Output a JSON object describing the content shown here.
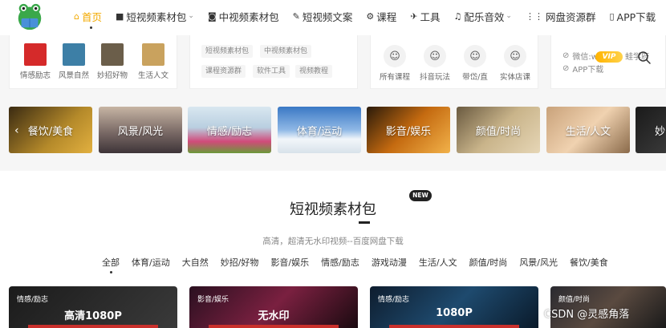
{
  "nav": {
    "items": [
      {
        "label": "首页",
        "icon": "home-icon",
        "glyph": "⌂"
      },
      {
        "label": "短视频素材包",
        "icon": "video-camera-icon",
        "glyph": "■",
        "caret": "⌄"
      },
      {
        "label": "中视频素材包",
        "icon": "camera-icon",
        "glyph": "◙"
      },
      {
        "label": "短视频文案",
        "icon": "pen-icon",
        "glyph": "✎"
      },
      {
        "label": "课程",
        "icon": "gear-icon",
        "glyph": "⚙"
      },
      {
        "label": "工具",
        "icon": "pin-icon",
        "glyph": "✈"
      },
      {
        "label": "配乐音效",
        "icon": "music-icon",
        "glyph": "♫",
        "caret": "⌄"
      },
      {
        "label": "网盘资源群",
        "icon": "grid-icon",
        "glyph": "⋮⋮"
      },
      {
        "label": "APP下载",
        "icon": "phone-icon",
        "glyph": "▯"
      }
    ]
  },
  "panel1": {
    "items": [
      {
        "label": "情感励志",
        "color": "#d52a2a"
      },
      {
        "label": "风景自然",
        "color": "#3d7fa6"
      },
      {
        "label": "妙招好物",
        "color": "#6b5e4a"
      },
      {
        "label": "生活人文",
        "color": "#c9a25e"
      }
    ]
  },
  "panel2": {
    "tags": [
      "短视频素材包",
      "中视频素材包",
      "课程资源群",
      "软件工具",
      "视频教程"
    ]
  },
  "panel3": {
    "items": [
      {
        "label": "所有课程",
        "glyph": "☺"
      },
      {
        "label": "抖音玩法",
        "glyph": "☺"
      },
      {
        "label": "带岱/直",
        "glyph": "☺"
      },
      {
        "label": "实体店课",
        "glyph": "☺"
      }
    ]
  },
  "panel4": {
    "wechat": "微信:w",
    "wechat_suffix": "蛙学府",
    "app": "APP下载",
    "vip": "VIP"
  },
  "strip": {
    "prev": "‹",
    "cats": [
      {
        "label": "餐饮/美食",
        "bg": "linear-gradient(135deg,#3a2a12,#b58a2a 60%,#e2b040)"
      },
      {
        "label": "风景/风光",
        "bg": "linear-gradient(180deg,#c7b5a4,#7a6a66 55%,#3e3438)"
      },
      {
        "label": "情感/励志",
        "bg": "linear-gradient(180deg,#d9e7f0,#b9cfe0 45%,#d14a7a 75%,#6a9a3a)"
      },
      {
        "label": "体育/运动",
        "bg": "linear-gradient(180deg,#3a78c4,#8fb8e6 50%,#f2f6fa 70%,#d8e2ea)"
      },
      {
        "label": "影音/娱乐",
        "bg": "linear-gradient(135deg,#2a1a0a,#c46a10 50%,#f2b24a)"
      },
      {
        "label": "颜值/时尚",
        "bg": "linear-gradient(135deg,#6a5a40,#c9b48a 50%,#e6d6b6)"
      },
      {
        "label": "生活/人文",
        "bg": "linear-gradient(135deg,#c9a27a,#f0d2b0 50%,#8a6a4a)"
      },
      {
        "label": "妙",
        "bg": "linear-gradient(135deg,#1a1a1a,#3a3a3a)"
      }
    ]
  },
  "section": {
    "title": "短视频素材包",
    "badge": "NEW",
    "subtitle": "高清，超清无水印视频--百度网盘下载",
    "filters": [
      "全部",
      "体育/运动",
      "大自然",
      "妙招/好物",
      "影音/娱乐",
      "情感/励志",
      "游戏动漫",
      "生活/人文",
      "颜值/时尚",
      "风景/风光",
      "餐饮/美食"
    ]
  },
  "cards": [
    {
      "tag": "情感/励志",
      "title": "高清1080P",
      "bg": "linear-gradient(135deg,#1b1b1b,#3a3a3a)"
    },
    {
      "tag": "影音/娱乐",
      "title": "无水印",
      "bg": "linear-gradient(135deg,#2a1020,#7a2040 50%,#1a0a10)"
    },
    {
      "tag": "情感/励志",
      "title": "1080P",
      "bg": "linear-gradient(135deg,#0e1d2e,#1e4a6e 50%,#0a1a2a)"
    },
    {
      "tag": "颜值/时尚",
      "title": "",
      "bg": "linear-gradient(135deg,#2a2a30,#5a4a40 50%,#1a1a1a)"
    }
  ],
  "watermark": "CSDN @灵感角落"
}
